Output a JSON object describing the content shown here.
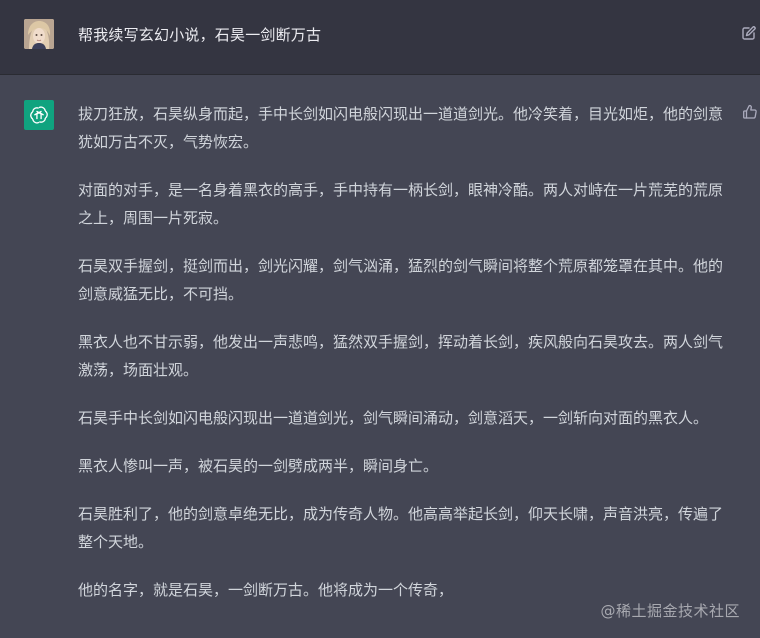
{
  "user_message": {
    "text": "帮我续写玄幻小说，石昊一剑断万古"
  },
  "assistant_message": {
    "paragraphs": [
      "拔刀狂放，石昊纵身而起，手中长剑如闪电般闪现出一道道剑光。他冷笑着，目光如炬，他的剑意犹如万古不灭，气势恢宏。",
      "对面的对手，是一名身着黑衣的高手，手中持有一柄长剑，眼神冷酷。两人对峙在一片荒芜的荒原之上，周围一片死寂。",
      "石昊双手握剑，挺剑而出，剑光闪耀，剑气汹涌，猛烈的剑气瞬间将整个荒原都笼罩在其中。他的剑意威猛无比，不可挡。",
      "黑衣人也不甘示弱，他发出一声悲鸣，猛然双手握剑，挥动着长剑，疾风般向石昊攻去。两人剑气激荡，场面壮观。",
      "石昊手中长剑如闪电般闪现出一道道剑光，剑气瞬间涌动，剑意滔天，一剑斩向对面的黑衣人。",
      "黑衣人惨叫一声，被石昊的一剑劈成两半，瞬间身亡。",
      "石昊胜利了，他的剑意卓绝无比，成为传奇人物。他高高举起长剑，仰天长啸，声音洪亮，传遍了整个天地。",
      "他的名字，就是石昊，一剑断万古。他将成为一个传奇，"
    ]
  },
  "watermark": "@稀土掘金技术社区",
  "icons": {
    "user_avatar": "user-avatar",
    "edit": "edit-icon",
    "assistant_avatar": "openai-logo-icon",
    "thumbs_up": "thumbs-up-icon"
  },
  "colors": {
    "user_bg": "#343541",
    "assistant_bg": "#444654",
    "brand": "#10a37f",
    "text": "#d1d5db"
  }
}
